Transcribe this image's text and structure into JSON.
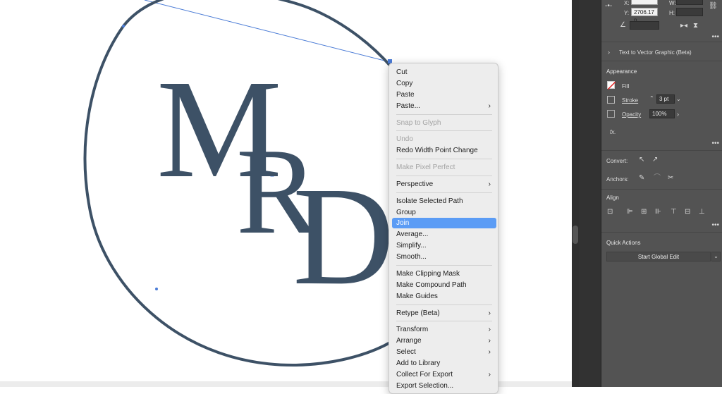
{
  "context_menu": {
    "items": [
      {
        "label": "Cut",
        "disabled": false
      },
      {
        "label": "Copy",
        "disabled": false
      },
      {
        "label": "Paste",
        "disabled": false
      },
      {
        "label": "Paste...",
        "disabled": false,
        "submenu": true
      },
      {
        "separator": true
      },
      {
        "label": "Snap to Glyph",
        "disabled": true
      },
      {
        "separator": true
      },
      {
        "label": "Undo",
        "disabled": true
      },
      {
        "label": "Redo Width Point Change",
        "disabled": false
      },
      {
        "separator": true
      },
      {
        "label": "Make Pixel Perfect",
        "disabled": true
      },
      {
        "separator": true
      },
      {
        "label": "Perspective",
        "disabled": false,
        "submenu": true
      },
      {
        "separator": true
      },
      {
        "label": "Isolate Selected Path",
        "disabled": false
      },
      {
        "label": "Group",
        "disabled": false
      },
      {
        "label": "Join",
        "disabled": false,
        "highlighted": true
      },
      {
        "label": "Average...",
        "disabled": false
      },
      {
        "label": "Simplify...",
        "disabled": false
      },
      {
        "label": "Smooth...",
        "disabled": false
      },
      {
        "separator": true
      },
      {
        "label": "Make Clipping Mask",
        "disabled": false
      },
      {
        "label": "Make Compound Path",
        "disabled": false
      },
      {
        "label": "Make Guides",
        "disabled": false
      },
      {
        "separator": true
      },
      {
        "label": "Retype (Beta)",
        "disabled": false,
        "submenu": true
      },
      {
        "separator": true
      },
      {
        "label": "Transform",
        "disabled": false,
        "submenu": true
      },
      {
        "label": "Arrange",
        "disabled": false,
        "submenu": true
      },
      {
        "label": "Select",
        "disabled": false,
        "submenu": true
      },
      {
        "label": "Add to Library",
        "disabled": false
      },
      {
        "label": "Collect For Export",
        "disabled": false,
        "submenu": true
      },
      {
        "label": "Export Selection...",
        "disabled": false
      }
    ],
    "submenu_glyph": "›"
  },
  "artwork": {
    "letters": [
      "M",
      "R",
      "D"
    ],
    "stroke_color": "#3d5166",
    "selection_color": "#4a7bd6"
  },
  "properties": {
    "transform": {
      "x_label": "X:",
      "y_label": "Y:",
      "y_value": "2706.17 p",
      "h_label": "H:",
      "w_label": "W:"
    },
    "text_to_vector": "Text to Vector Graphic (Beta)",
    "appearance": {
      "title": "Appearance",
      "fill_label": "Fill",
      "stroke_label": "Stroke",
      "stroke_value": "3 pt",
      "opacity_label": "Opacity",
      "opacity_value": "100%",
      "fx_label": "fx."
    },
    "convert_label": "Convert:",
    "anchors_label": "Anchors:",
    "align_title": "Align",
    "quick_actions": {
      "title": "Quick Actions",
      "button": "Start Global Edit"
    },
    "more_glyph": "•••"
  },
  "colors": {
    "menu_highlight": "#5b9cf5",
    "panel_bg": "#535353",
    "monogram": "#3d5166"
  }
}
